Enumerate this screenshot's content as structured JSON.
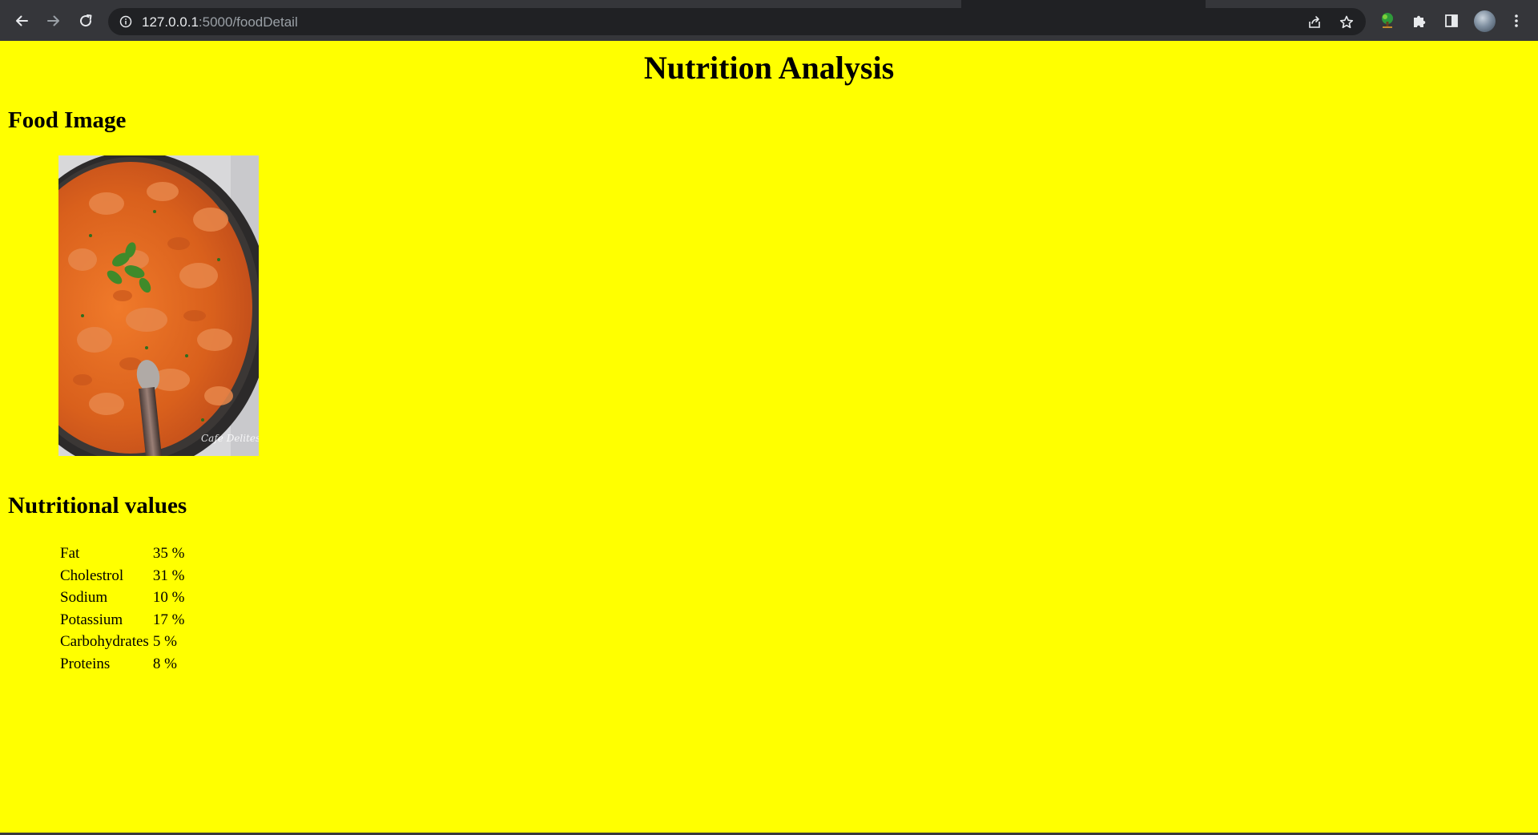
{
  "browser": {
    "url_host": "127.0.0.1",
    "url_path": ":5000/foodDetail",
    "icons": {
      "back": "back-arrow-icon",
      "forward": "forward-arrow-icon",
      "reload": "reload-icon",
      "site_info": "info-icon",
      "share": "share-icon",
      "bookmark": "star-icon",
      "extension": "tree-extension-icon",
      "extensions_menu": "puzzle-icon",
      "side_panel": "side-panel-icon",
      "profile": "avatar",
      "menu": "kebab-menu-icon"
    }
  },
  "page": {
    "title": "Nutrition Analysis",
    "food_image_heading": "Food Image",
    "nutrition_heading": "Nutritional values",
    "nutrients": [
      {
        "name": "Fat",
        "value": "35 %"
      },
      {
        "name": "Cholestrol",
        "value": "31 %"
      },
      {
        "name": "Sodium",
        "value": "10 %"
      },
      {
        "name": "Potassium",
        "value": "17 %"
      },
      {
        "name": "Carbohydrates",
        "value": "5 %"
      },
      {
        "name": "Proteins",
        "value": "8 %"
      }
    ],
    "image_watermark": "Cafe Delites"
  },
  "colors": {
    "page_background": "#ffff00",
    "chrome_background": "#35363a",
    "omnibox_background": "#202124"
  }
}
